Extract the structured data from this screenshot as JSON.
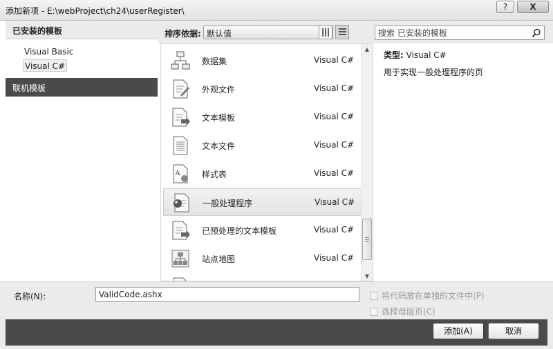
{
  "window": {
    "title": "添加新项 - E:\\webProject\\ch24\\userRegister\\",
    "help_label": "?",
    "close_label": "X"
  },
  "left_panel": {
    "header": "已安装的模板",
    "items": [
      {
        "label": "Visual Basic"
      },
      {
        "label": "Visual C#"
      }
    ],
    "online_templates": "联机模板"
  },
  "toolbar": {
    "sort_label": "排序依据:",
    "sort_value": "默认值",
    "search_placeholder": "搜索 已安装的模板"
  },
  "templates": [
    {
      "name": "数据集",
      "lang": "Visual C#",
      "icon": "dataset-icon"
    },
    {
      "name": "外观文件",
      "lang": "Visual C#",
      "icon": "skin-file-icon"
    },
    {
      "name": "文本模板",
      "lang": "Visual C#",
      "icon": "text-template-icon"
    },
    {
      "name": "文本文件",
      "lang": "Visual C#",
      "icon": "text-file-icon"
    },
    {
      "name": "样式表",
      "lang": "Visual C#",
      "icon": "stylesheet-icon"
    },
    {
      "name": "一般处理程序",
      "lang": "Visual C#",
      "icon": "generic-handler-icon"
    },
    {
      "name": "已预处理的文本模板",
      "lang": "Visual C#",
      "icon": "preprocessed-template-icon"
    },
    {
      "name": "站点地图",
      "lang": "Visual C#",
      "icon": "sitemap-icon"
    },
    {
      "name": "",
      "lang": "",
      "icon": "partial-item-icon"
    }
  ],
  "details": {
    "type_label": "类型:",
    "type_value": "Visual C#",
    "description": "用于实现一般处理程序的页"
  },
  "bottom": {
    "name_label": "名称(N):",
    "name_value": "ValidCode.ashx",
    "checkbox_separate_file": "将代码放在单独的文件中(P)",
    "checkbox_master_page": "选择母版页(C)",
    "add_button": "添加(A)",
    "cancel_button": "取消"
  }
}
